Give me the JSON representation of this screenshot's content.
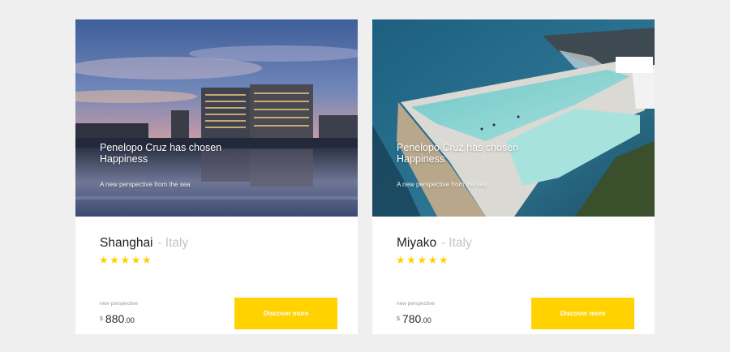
{
  "cards": [
    {
      "overlay_title": "Penelopo Cruz has chosen Happiness",
      "overlay_subtitle": "A new perspective from the sea",
      "city": "Shanghai",
      "separator": "-",
      "country": "Italy",
      "rating": 5,
      "stars": "★★★★★",
      "perspective_label": "new perspective",
      "currency": "$",
      "price_main": "880",
      "price_cents": ".00",
      "button_label": "Discover more",
      "accent_color": "#ffd200",
      "image": "city-waterfront-dusk"
    },
    {
      "overlay_title": "Penelopo Cruz has chosen Happiness",
      "overlay_subtitle": "A new perspective from the sea",
      "city": "Miyako",
      "separator": "-",
      "country": "Italy",
      "rating": 5,
      "stars": "★★★★★",
      "perspective_label": "new perspective",
      "currency": "$",
      "price_main": "780",
      "price_cents": ".00",
      "button_label": "Discover more",
      "accent_color": "#ffd200",
      "image": "ocean-pool-aerial"
    }
  ]
}
